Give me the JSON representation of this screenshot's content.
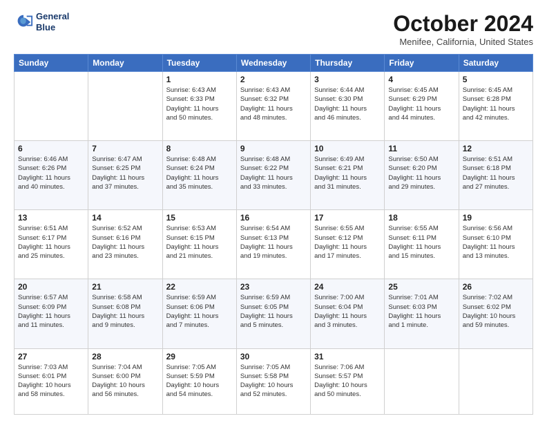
{
  "header": {
    "logo_line1": "General",
    "logo_line2": "Blue",
    "month": "October 2024",
    "location": "Menifee, California, United States"
  },
  "weekdays": [
    "Sunday",
    "Monday",
    "Tuesday",
    "Wednesday",
    "Thursday",
    "Friday",
    "Saturday"
  ],
  "weeks": [
    [
      {
        "day": "",
        "content": ""
      },
      {
        "day": "",
        "content": ""
      },
      {
        "day": "1",
        "content": "Sunrise: 6:43 AM\nSunset: 6:33 PM\nDaylight: 11 hours\nand 50 minutes."
      },
      {
        "day": "2",
        "content": "Sunrise: 6:43 AM\nSunset: 6:32 PM\nDaylight: 11 hours\nand 48 minutes."
      },
      {
        "day": "3",
        "content": "Sunrise: 6:44 AM\nSunset: 6:30 PM\nDaylight: 11 hours\nand 46 minutes."
      },
      {
        "day": "4",
        "content": "Sunrise: 6:45 AM\nSunset: 6:29 PM\nDaylight: 11 hours\nand 44 minutes."
      },
      {
        "day": "5",
        "content": "Sunrise: 6:45 AM\nSunset: 6:28 PM\nDaylight: 11 hours\nand 42 minutes."
      }
    ],
    [
      {
        "day": "6",
        "content": "Sunrise: 6:46 AM\nSunset: 6:26 PM\nDaylight: 11 hours\nand 40 minutes."
      },
      {
        "day": "7",
        "content": "Sunrise: 6:47 AM\nSunset: 6:25 PM\nDaylight: 11 hours\nand 37 minutes."
      },
      {
        "day": "8",
        "content": "Sunrise: 6:48 AM\nSunset: 6:24 PM\nDaylight: 11 hours\nand 35 minutes."
      },
      {
        "day": "9",
        "content": "Sunrise: 6:48 AM\nSunset: 6:22 PM\nDaylight: 11 hours\nand 33 minutes."
      },
      {
        "day": "10",
        "content": "Sunrise: 6:49 AM\nSunset: 6:21 PM\nDaylight: 11 hours\nand 31 minutes."
      },
      {
        "day": "11",
        "content": "Sunrise: 6:50 AM\nSunset: 6:20 PM\nDaylight: 11 hours\nand 29 minutes."
      },
      {
        "day": "12",
        "content": "Sunrise: 6:51 AM\nSunset: 6:18 PM\nDaylight: 11 hours\nand 27 minutes."
      }
    ],
    [
      {
        "day": "13",
        "content": "Sunrise: 6:51 AM\nSunset: 6:17 PM\nDaylight: 11 hours\nand 25 minutes."
      },
      {
        "day": "14",
        "content": "Sunrise: 6:52 AM\nSunset: 6:16 PM\nDaylight: 11 hours\nand 23 minutes."
      },
      {
        "day": "15",
        "content": "Sunrise: 6:53 AM\nSunset: 6:15 PM\nDaylight: 11 hours\nand 21 minutes."
      },
      {
        "day": "16",
        "content": "Sunrise: 6:54 AM\nSunset: 6:13 PM\nDaylight: 11 hours\nand 19 minutes."
      },
      {
        "day": "17",
        "content": "Sunrise: 6:55 AM\nSunset: 6:12 PM\nDaylight: 11 hours\nand 17 minutes."
      },
      {
        "day": "18",
        "content": "Sunrise: 6:55 AM\nSunset: 6:11 PM\nDaylight: 11 hours\nand 15 minutes."
      },
      {
        "day": "19",
        "content": "Sunrise: 6:56 AM\nSunset: 6:10 PM\nDaylight: 11 hours\nand 13 minutes."
      }
    ],
    [
      {
        "day": "20",
        "content": "Sunrise: 6:57 AM\nSunset: 6:09 PM\nDaylight: 11 hours\nand 11 minutes."
      },
      {
        "day": "21",
        "content": "Sunrise: 6:58 AM\nSunset: 6:08 PM\nDaylight: 11 hours\nand 9 minutes."
      },
      {
        "day": "22",
        "content": "Sunrise: 6:59 AM\nSunset: 6:06 PM\nDaylight: 11 hours\nand 7 minutes."
      },
      {
        "day": "23",
        "content": "Sunrise: 6:59 AM\nSunset: 6:05 PM\nDaylight: 11 hours\nand 5 minutes."
      },
      {
        "day": "24",
        "content": "Sunrise: 7:00 AM\nSunset: 6:04 PM\nDaylight: 11 hours\nand 3 minutes."
      },
      {
        "day": "25",
        "content": "Sunrise: 7:01 AM\nSunset: 6:03 PM\nDaylight: 11 hours\nand 1 minute."
      },
      {
        "day": "26",
        "content": "Sunrise: 7:02 AM\nSunset: 6:02 PM\nDaylight: 10 hours\nand 59 minutes."
      }
    ],
    [
      {
        "day": "27",
        "content": "Sunrise: 7:03 AM\nSunset: 6:01 PM\nDaylight: 10 hours\nand 58 minutes."
      },
      {
        "day": "28",
        "content": "Sunrise: 7:04 AM\nSunset: 6:00 PM\nDaylight: 10 hours\nand 56 minutes."
      },
      {
        "day": "29",
        "content": "Sunrise: 7:05 AM\nSunset: 5:59 PM\nDaylight: 10 hours\nand 54 minutes."
      },
      {
        "day": "30",
        "content": "Sunrise: 7:05 AM\nSunset: 5:58 PM\nDaylight: 10 hours\nand 52 minutes."
      },
      {
        "day": "31",
        "content": "Sunrise: 7:06 AM\nSunset: 5:57 PM\nDaylight: 10 hours\nand 50 minutes."
      },
      {
        "day": "",
        "content": ""
      },
      {
        "day": "",
        "content": ""
      }
    ]
  ]
}
